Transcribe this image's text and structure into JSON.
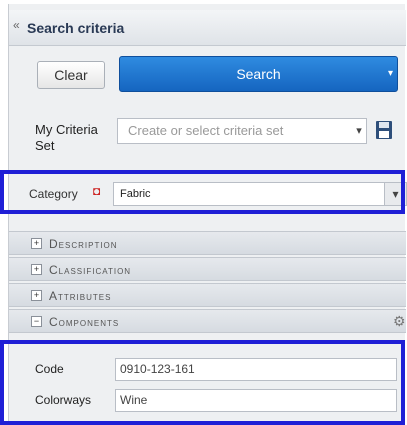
{
  "header": {
    "title": "Search criteria",
    "collapse_glyph": "«"
  },
  "toolbar": {
    "clear_label": "Clear",
    "search_label": "Search",
    "search_dropdown_glyph": "▾"
  },
  "criteria": {
    "label": "My Criteria Set",
    "placeholder": "Create or select criteria set",
    "dropdown_glyph": "▾"
  },
  "category": {
    "label": "Category",
    "required_glyph": "◘",
    "value": "Fabric",
    "dropdown_glyph": "▾"
  },
  "sections": [
    {
      "label": "Description",
      "toggle": "+"
    },
    {
      "label": "Classification",
      "toggle": "+"
    },
    {
      "label": "Attributes",
      "toggle": "+"
    },
    {
      "label": "Components",
      "toggle": "−"
    }
  ],
  "fields": {
    "code": {
      "label": "Code",
      "value": "0910-123-161"
    },
    "colorways": {
      "label": "Colorways",
      "value": "Wine"
    }
  },
  "icons": {
    "collapse": "double-chevron-left-icon",
    "save": "floppy-disk-icon",
    "settings": "gear-icon",
    "required": "required-icon"
  },
  "colors": {
    "search_button": "#1f6fc9",
    "highlight_box": "#1f1fd6",
    "panel_bg": "#eef0f2"
  }
}
